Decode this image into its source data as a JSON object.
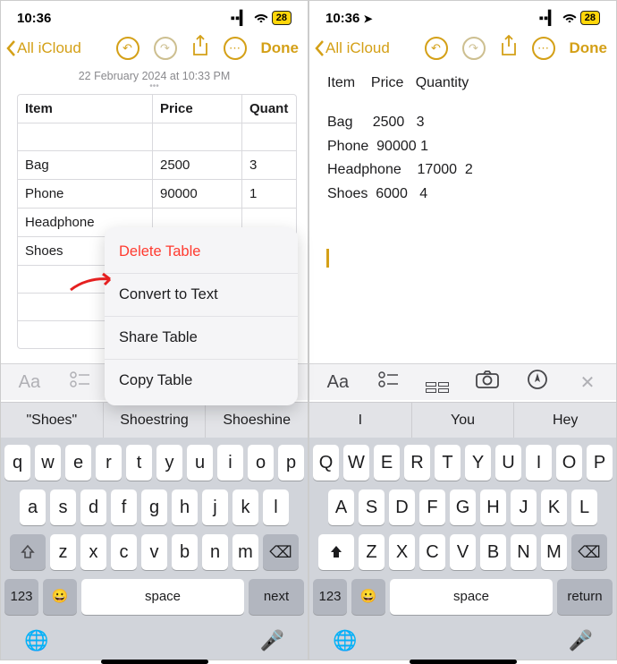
{
  "left": {
    "status": {
      "time": "10:36",
      "battery": "28"
    },
    "nav": {
      "back": "All iCloud",
      "done": "Done"
    },
    "timestamp": "22 February 2024 at 10:33 PM",
    "table": {
      "headers": [
        "Item",
        "Price",
        "Quant"
      ],
      "rows": [
        [
          "Bag",
          "2500",
          "3"
        ],
        [
          "Phone",
          "90000",
          "1"
        ],
        [
          "Headphone",
          "",
          ""
        ],
        [
          "Shoes",
          "",
          ""
        ]
      ]
    },
    "menu": [
      "Delete Table",
      "Convert to Text",
      "Share Table",
      "Copy Table"
    ],
    "suggestions": [
      "\"Shoes\"",
      "Shoestring",
      "Shoeshine"
    ],
    "keyboard": {
      "r1": [
        "q",
        "w",
        "e",
        "r",
        "t",
        "y",
        "u",
        "i",
        "o",
        "p"
      ],
      "r2": [
        "a",
        "s",
        "d",
        "f",
        "g",
        "h",
        "j",
        "k",
        "l"
      ],
      "r3": [
        "z",
        "x",
        "c",
        "v",
        "b",
        "n",
        "m"
      ],
      "fn": "123",
      "space": "space",
      "ret": "next"
    }
  },
  "right": {
    "status": {
      "time": "10:36",
      "battery": "28"
    },
    "nav": {
      "back": "All iCloud",
      "done": "Done"
    },
    "plain": {
      "header": "Item    Price   Quantity",
      "rows": [
        "Bag     2500   3",
        "Phone  90000 1",
        "Headphone    17000  2",
        "Shoes  6000   4"
      ]
    },
    "suggestions": [
      "I",
      "You",
      "Hey"
    ],
    "keyboard": {
      "r1": [
        "Q",
        "W",
        "E",
        "R",
        "T",
        "Y",
        "U",
        "I",
        "O",
        "P"
      ],
      "r2": [
        "A",
        "S",
        "D",
        "F",
        "G",
        "H",
        "J",
        "K",
        "L"
      ],
      "r3": [
        "Z",
        "X",
        "C",
        "V",
        "B",
        "N",
        "M"
      ],
      "fn": "123",
      "space": "space",
      "ret": "return"
    }
  }
}
